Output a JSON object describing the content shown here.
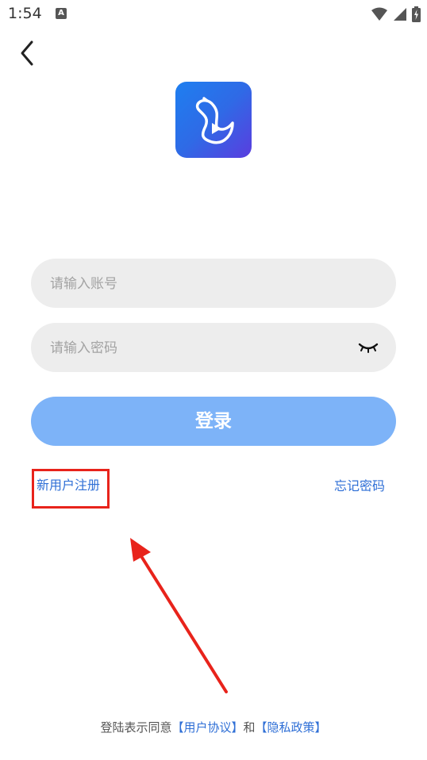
{
  "status_bar": {
    "time": "1:54",
    "notification_letter": "A"
  },
  "icons": {
    "back": "chevron-left-icon",
    "logo": "swan-play-logo",
    "eye": "eye-closed-icon"
  },
  "form": {
    "account_placeholder": "请输入账号",
    "password_placeholder": "请输入密码",
    "login_label": "登录"
  },
  "links": {
    "register": "新用户注册",
    "forgot": "忘记密码"
  },
  "agreement": {
    "prefix": "登陆表示同意",
    "user_agreement": "【用户协议】",
    "conjunction": "和",
    "privacy_policy": "【隐私政策】"
  },
  "colors": {
    "accent": "#2f6fd6",
    "login_button": "#7db3f8",
    "highlight": "#e8231b"
  }
}
